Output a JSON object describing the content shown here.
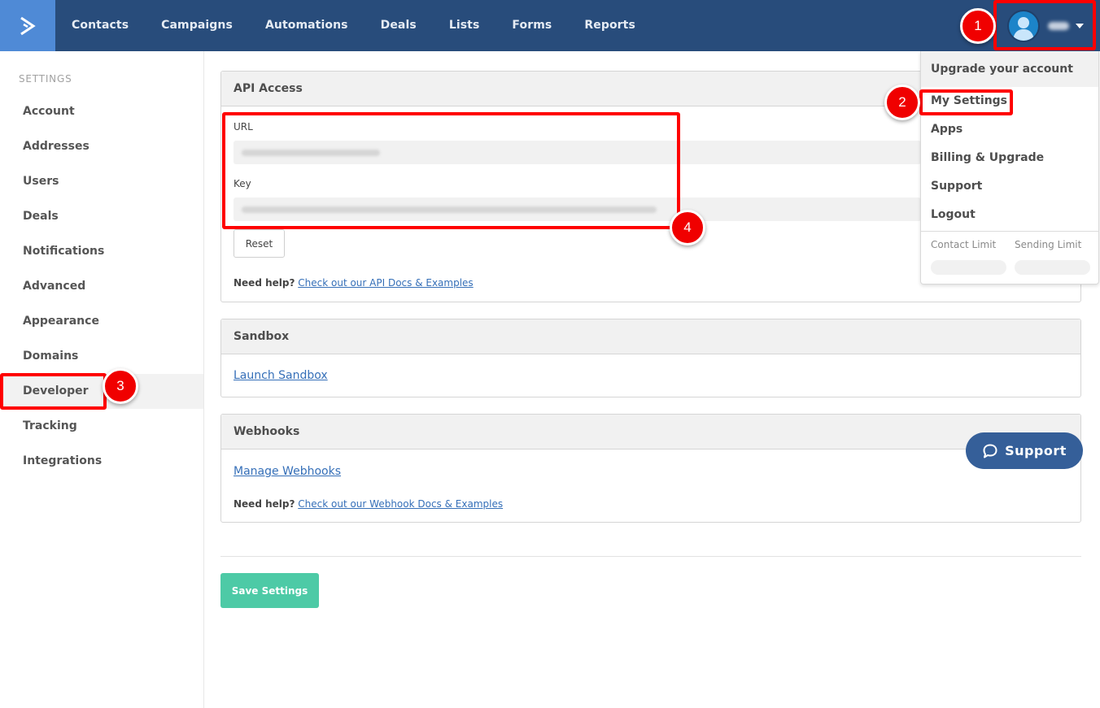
{
  "topnav": {
    "logo_icon": "chevron-right-icon",
    "items": [
      {
        "label": "Contacts"
      },
      {
        "label": "Campaigns"
      },
      {
        "label": "Automations"
      },
      {
        "label": "Deals"
      },
      {
        "label": "Lists"
      },
      {
        "label": "Forms"
      },
      {
        "label": "Reports"
      }
    ],
    "user": {
      "avatar_icon": "user-avatar-icon",
      "name": "(blurred)",
      "caret_icon": "caret-down-icon"
    }
  },
  "sidebar": {
    "heading": "SETTINGS",
    "items": [
      {
        "label": "Account",
        "active": false
      },
      {
        "label": "Addresses",
        "active": false
      },
      {
        "label": "Users",
        "active": false
      },
      {
        "label": "Deals",
        "active": false
      },
      {
        "label": "Notifications",
        "active": false
      },
      {
        "label": "Advanced",
        "active": false
      },
      {
        "label": "Appearance",
        "active": false
      },
      {
        "label": "Domains",
        "active": false
      },
      {
        "label": "Developer",
        "active": true
      },
      {
        "label": "Tracking",
        "active": false
      },
      {
        "label": "Integrations",
        "active": false
      }
    ]
  },
  "api_access": {
    "title": "API Access",
    "url_label": "URL",
    "url_value": "(blurred)",
    "key_label": "Key",
    "key_value": "(blurred)",
    "reset_label": "Reset",
    "help_prefix": "Need help?",
    "help_link": "Check out our API Docs & Examples"
  },
  "sandbox": {
    "title": "Sandbox",
    "link": "Launch Sandbox"
  },
  "webhooks": {
    "title": "Webhooks",
    "link": "Manage Webhooks",
    "help_prefix": "Need help?",
    "help_link": "Check out our Webhook Docs & Examples"
  },
  "save_label": "Save Settings",
  "dropdown": {
    "upgrade": "Upgrade your account",
    "items": [
      {
        "label": "My Settings"
      },
      {
        "label": "Apps"
      },
      {
        "label": "Billing & Upgrade"
      },
      {
        "label": "Support"
      },
      {
        "label": "Logout"
      }
    ],
    "contact_limit_label": "Contact Limit",
    "sending_limit_label": "Sending Limit"
  },
  "support_widget": {
    "label": "Support",
    "icon": "chat-bubble-icon"
  },
  "annotations": [
    {
      "number": "1",
      "target": "user-menu"
    },
    {
      "number": "2",
      "target": "My Settings"
    },
    {
      "number": "3",
      "target": "Developer"
    },
    {
      "number": "4",
      "target": "API URL and Key"
    }
  ],
  "colors": {
    "nav_bg": "#284c7b",
    "logo_bg": "#4f8ad6",
    "save_button": "#4dcaa6",
    "link": "#356fb8",
    "support_button": "#355f99",
    "annotation_red": "#ff0000"
  }
}
